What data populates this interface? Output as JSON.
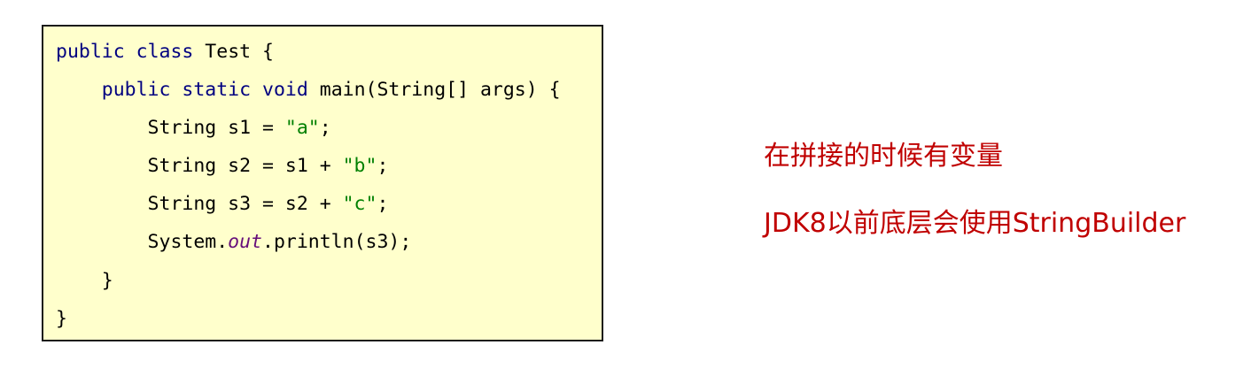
{
  "code": {
    "lines": [
      [
        {
          "t": "public",
          "c": "kw"
        },
        {
          "t": " "
        },
        {
          "t": "class",
          "c": "kw"
        },
        {
          "t": " Test {"
        }
      ],
      [
        {
          "t": "    "
        },
        {
          "t": "public",
          "c": "kw"
        },
        {
          "t": " "
        },
        {
          "t": "static",
          "c": "kw"
        },
        {
          "t": " "
        },
        {
          "t": "void",
          "c": "kw"
        },
        {
          "t": " main(String[] args) {"
        }
      ],
      [
        {
          "t": "        String s1 = "
        },
        {
          "t": "\"a\"",
          "c": "str"
        },
        {
          "t": ";"
        }
      ],
      [
        {
          "t": "        String s2 = s1 + "
        },
        {
          "t": "\"b\"",
          "c": "str"
        },
        {
          "t": ";"
        }
      ],
      [
        {
          "t": "        String s3 = s2 + "
        },
        {
          "t": "\"c\"",
          "c": "str"
        },
        {
          "t": ";"
        }
      ],
      [
        {
          "t": "        System."
        },
        {
          "t": "out",
          "c": "fld"
        },
        {
          "t": ".println(s3);"
        }
      ],
      [
        {
          "t": "    }"
        }
      ],
      [
        {
          "t": "}"
        }
      ]
    ]
  },
  "notes": {
    "line1": "在拼接的时候有变量",
    "line2": "JDK8以前底层会使用StringBuilder"
  },
  "colors": {
    "code_background": "#ffffcc",
    "keyword": "#000080",
    "string_literal": "#008000",
    "static_field": "#660e7a",
    "note_text": "#c00000"
  }
}
